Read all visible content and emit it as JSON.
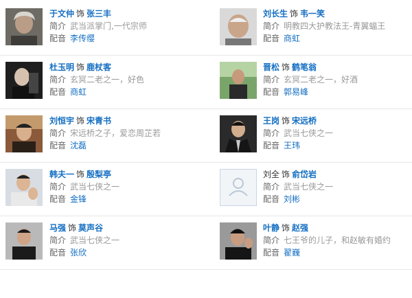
{
  "labels": {
    "plays": "饰",
    "intro": "简介",
    "voice": "配音"
  },
  "cast": [
    {
      "actor": "于文仲",
      "role": "张三丰",
      "intro": "武当派掌门,一代宗师",
      "dubber": "李传缨",
      "photo": "tone-gray"
    },
    {
      "actor": "刘长生",
      "role": "韦一笑",
      "intro": "明教四大护教法王-青翼蝠王",
      "dubber": "商虹",
      "photo": "tone-light"
    },
    {
      "actor": "杜玉明",
      "role": "鹿杖客",
      "intro": "玄冥二老之一，好色",
      "dubber": "商虹",
      "photo": "tone-dark"
    },
    {
      "actor": "晋松",
      "role": "鹤笔翁",
      "intro": "玄冥二老之一，好酒",
      "dubber": "郭易峰",
      "photo": "tone-green"
    },
    {
      "actor": "刘恒宇",
      "role": "宋青书",
      "intro": "宋远桥之子，爱恋周芷若",
      "dubber": "沈磊",
      "photo": "tone-brown"
    },
    {
      "actor": "王岗",
      "role": "宋远桥",
      "intro": "武当七侠之一",
      "dubber": "王玮",
      "photo": "tone-dark"
    },
    {
      "actor": "韩夫一",
      "role": "殷梨亭",
      "intro": "武当七侠之一",
      "dubber": "金锋",
      "photo": "tone-light"
    },
    {
      "actor": "刘全",
      "role": "俞岱岩",
      "intro": "武当七侠之一",
      "dubber": "刘彬",
      "photo": "placeholder"
    },
    {
      "actor": "马强",
      "role": "莫声谷",
      "intro": "武当七侠之一",
      "dubber": "张欣",
      "photo": "tone-dark"
    },
    {
      "actor": "叶静",
      "role": "赵强",
      "intro": "七王爷的儿子，和赵敏有婚约",
      "dubber": "翟巍",
      "photo": "tone-gray"
    }
  ]
}
